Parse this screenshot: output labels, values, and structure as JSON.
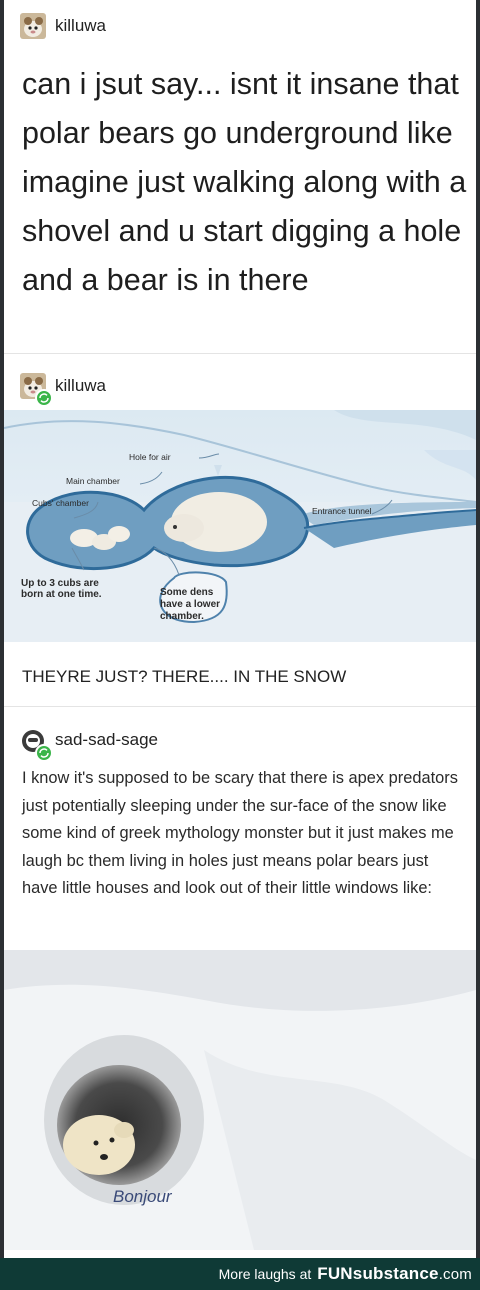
{
  "post1": {
    "username": "killuwa",
    "text": "can i jsut say... isnt it insane that polar bears go underground like imagine just walking along with a shovel and u start digging a hole and a bear is in there"
  },
  "post2": {
    "username": "killuwa",
    "diagram": {
      "hole_for_air": "Hole for air",
      "main_chamber": "Main chamber",
      "cubs_chamber": "Cubs' chamber",
      "entrance_tunnel": "Entrance tunnel",
      "cubs_note_line1": "Up to 3 cubs are",
      "cubs_note_line2": "born at one time.",
      "dens_note_line1": "Some dens",
      "dens_note_line2": "have a lower",
      "dens_note_line3": "chamber."
    },
    "caption": "THEYRE JUST? THERE.... IN THE SNOW"
  },
  "post3": {
    "username": "sad-sad-sage",
    "text": "I know it's supposed to be scary that there is apex predators just potentially sleeping under the sur-face of the snow like some kind of greek mythology monster but it just makes me laugh bc them living in holes just means polar bears just have little houses and look out of their little windows like:",
    "photo_caption": "Bonjour"
  },
  "footer": {
    "more_laughs": "More laughs at",
    "brand_fun": "FUN",
    "brand_substance": "substance",
    "brand_com": ".com"
  },
  "colors": {
    "footer_bg": "#0f3a36",
    "reblog_green": "#3bb54a",
    "sky_blue": "#dbeaf4",
    "caption_blue": "#3a4a78"
  },
  "icons": [
    "killuwa-avatar-icon",
    "sad-sad-sage-avatar-icon",
    "reblog-icon"
  ]
}
